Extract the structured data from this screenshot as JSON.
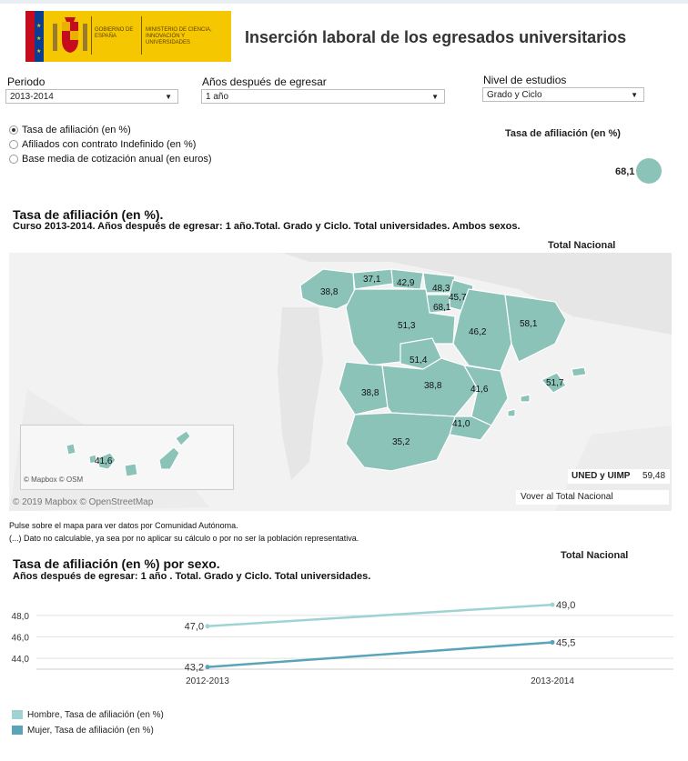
{
  "header": {
    "logo_text_1": "GOBIERNO DE ESPAÑA",
    "logo_text_2": "MINISTERIO DE CIENCIA, INNOVACIÓN Y UNIVERSIDADES",
    "title": "Inserción laboral de los egresados universitarios"
  },
  "filters": {
    "periodo_label": "Periodo",
    "periodo_value": "2013-2014",
    "anios_label": "Años después de egresar",
    "anios_value": "1 año",
    "nivel_label": "Nivel de estudios",
    "nivel_value": "Grado y Ciclo"
  },
  "measures": {
    "options": [
      {
        "label": "Tasa de afiliación (en %)",
        "selected": true
      },
      {
        "label": "Afiliados con contrato Indefinido (en %)",
        "selected": false
      },
      {
        "label": "Base media de cotización anual (en euros)",
        "selected": false
      }
    ]
  },
  "kpi": {
    "title": "Tasa de afiliación (en %)",
    "value": "68,1"
  },
  "map_section": {
    "title": "Tasa de afiliación (en %).",
    "subtitle": "Curso 2013-2014. Años después de egresar: 1 año.Total. Grado y Ciclo. Total universidades. Ambos sexos.",
    "total_label": "Total Nacional",
    "regions": [
      {
        "name": "Galicia",
        "value": "38,8"
      },
      {
        "name": "Asturias",
        "value": "37,1"
      },
      {
        "name": "Cantabria",
        "value": "42,9"
      },
      {
        "name": "País Vasco",
        "value": "48,3"
      },
      {
        "name": "Navarra",
        "value": "45,7"
      },
      {
        "name": "La Rioja",
        "value": "68,1"
      },
      {
        "name": "Aragón",
        "value": "46,2"
      },
      {
        "name": "Cataluña",
        "value": "58,1"
      },
      {
        "name": "Castilla y León",
        "value": "51,3"
      },
      {
        "name": "Madrid",
        "value": "51,4"
      },
      {
        "name": "Extremadura",
        "value": "38,8"
      },
      {
        "name": "Castilla-La Mancha",
        "value": "38,8"
      },
      {
        "name": "Comunidad Valenciana",
        "value": "41,6"
      },
      {
        "name": "Baleares",
        "value": "51,7"
      },
      {
        "name": "Murcia",
        "value": "41,0"
      },
      {
        "name": "Andalucía",
        "value": "35,2"
      },
      {
        "name": "Canarias",
        "value": "41,6"
      }
    ],
    "inset_attribution": "© Mapbox  © OSM",
    "attribution": "© 2019 Mapbox  © OpenStreetMap",
    "uned_label": "UNED y UIMP",
    "uned_value": "59,48",
    "back_button": "Vover al Total Nacional",
    "note_1": "Pulse sobre el mapa para ver datos por Comunidad Autónoma.",
    "note_2": "(...) Dato no calculable, ya sea por no aplicar su cálculo o por no ser la población representativa."
  },
  "line_section": {
    "title": "Tasa de afiliación (en %) por sexo.",
    "subtitle": "Años después de egresar: 1 año . Total. Grado y Ciclo. Total universidades.",
    "total_label": "Total Nacional"
  },
  "chart_data": {
    "type": "line",
    "categories": [
      "2012-2013",
      "2013-2014"
    ],
    "series": [
      {
        "name": "Hombre, Tasa de afiliación (en %)",
        "values": [
          47.0,
          49.0
        ],
        "labels": [
          "47,0",
          "49,0"
        ],
        "color": "#9fd3d3"
      },
      {
        "name": "Mujer, Tasa de afiliación (en %)",
        "values": [
          43.2,
          45.5
        ],
        "labels": [
          "43,2",
          "45,5"
        ],
        "color": "#5aa3b8"
      }
    ],
    "yticks": [
      "44,0",
      "46,0",
      "48,0"
    ],
    "ytick_values": [
      44,
      46,
      48
    ],
    "ylim": [
      43,
      49.6
    ],
    "grid": true,
    "legend": "bottom-left"
  },
  "colors": {
    "map_fill": "#8cc3b9",
    "kpi_circle": "#8cc3b9",
    "hombre": "#9fd3d3",
    "mujer": "#5aa3b8"
  }
}
